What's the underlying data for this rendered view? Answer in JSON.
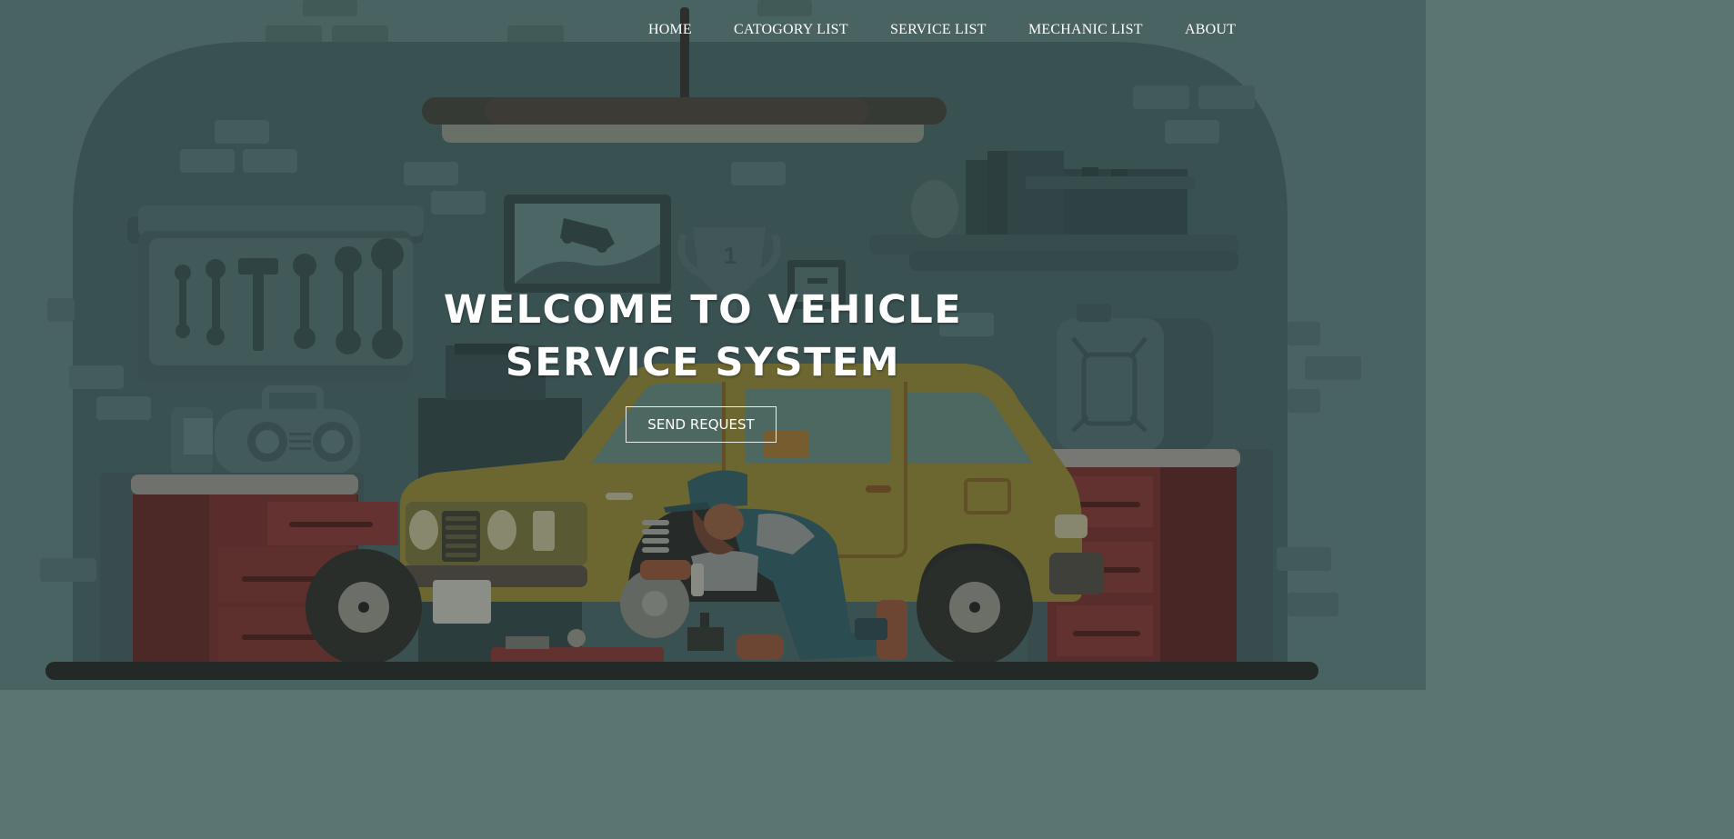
{
  "nav": {
    "home": "HOME",
    "category_list": "CATOGORY LIST",
    "service_list": "SERVICE LIST",
    "mechanic_list": "MECHANIC LIST",
    "about": "ABOUT"
  },
  "hero": {
    "title_line1": "WELCOME TO VEHICLE",
    "title_line2": "SERVICE SYSTEM",
    "button_label": "SEND REQUEST",
    "trophy_number": "1"
  },
  "colors": {
    "background": "#5a7672",
    "wall": "#425a59",
    "car": "#8a7a2c",
    "cabinet": "#7c2e2a",
    "text": "#ffffff"
  }
}
